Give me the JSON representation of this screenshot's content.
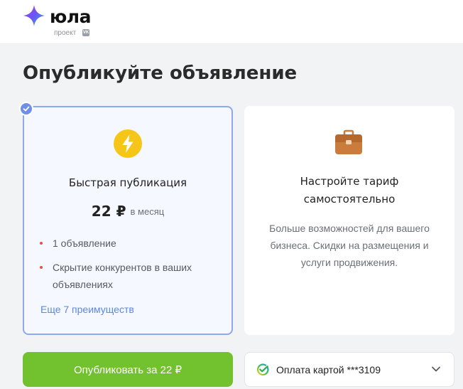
{
  "header": {
    "logo_text": "юла",
    "logo_sub": "проект",
    "vk_badge": "VK"
  },
  "page": {
    "title": "Опубликуйте объявление"
  },
  "plans": {
    "quick": {
      "selected": true,
      "title": "Быстрая публикация",
      "price": "22 ₽",
      "period": "в месяц",
      "features": [
        "1 объявление",
        "Скрытие конкурентов в ваших объявлениях"
      ],
      "more_link": "Еще 7 преимуществ"
    },
    "custom": {
      "title_line1": "Настройте тариф",
      "title_line2": "самостоятельно",
      "description": "Больше возможностей для вашего бизнеса. Скидки на размещения и услуги продвижения."
    }
  },
  "actions": {
    "publish_label": "Опубликовать за 22 ₽",
    "payment_label": "Оплата картой ***3109"
  },
  "icons": {
    "logo": "yula-star-logo",
    "selected": "check-icon",
    "quick_plan": "lightning-icon",
    "custom_plan": "briefcase-icon",
    "payment": "sber-pay-icon",
    "dropdown": "chevron-down-icon"
  },
  "colors": {
    "accent_green": "#72c12e",
    "selected_border": "#8fa8ea",
    "link_blue": "#5b86e5",
    "bullet_red": "#e8504a",
    "bolt_yellow": "#f5c518",
    "briefcase_brown": "#c97c3c"
  }
}
